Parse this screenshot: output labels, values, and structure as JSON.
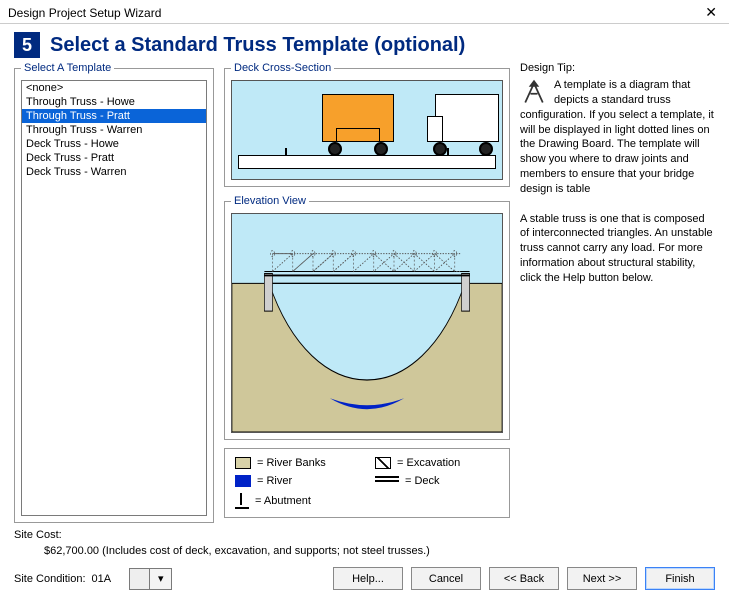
{
  "window": {
    "title": "Design Project Setup Wizard"
  },
  "step": {
    "number": "5",
    "title": "Select a Standard Truss Template (optional)"
  },
  "template_panel": {
    "legend": "Select A Template",
    "items": [
      "<none>",
      "Through Truss - Howe",
      "Through Truss - Pratt",
      "Through Truss - Warren",
      "Deck Truss - Howe",
      "Deck Truss - Pratt",
      "Deck Truss - Warren"
    ],
    "selected_index": 2
  },
  "deck_section": {
    "legend": "Deck Cross-Section"
  },
  "elevation": {
    "legend": "Elevation View"
  },
  "legend_items": {
    "banks": "= River Banks",
    "excavation": "= Excavation",
    "river": "= River",
    "deck": "= Deck",
    "abutment": "= Abutment"
  },
  "tip": {
    "label": "Design Tip:",
    "para1": "A template is a diagram that depicts a standard truss configuration. If you select a template, it will be displayed in light dotted lines on the Drawing Board. The template will show you where to draw joints and members to ensure that your bridge design is table",
    "para2": "A stable truss is one that is composed of interconnected triangles. An unstable truss cannot carry any load. For more information about structural stability, click the Help button below."
  },
  "site_cost": {
    "label": "Site Cost:",
    "value": "$62,700.00  (Includes cost of deck, excavation, and supports; not steel trusses.)"
  },
  "site_condition": {
    "label": "Site Condition:",
    "value": "01A"
  },
  "buttons": {
    "help": "Help...",
    "cancel": "Cancel",
    "back": "<< Back",
    "next": "Next >>",
    "finish": "Finish"
  }
}
